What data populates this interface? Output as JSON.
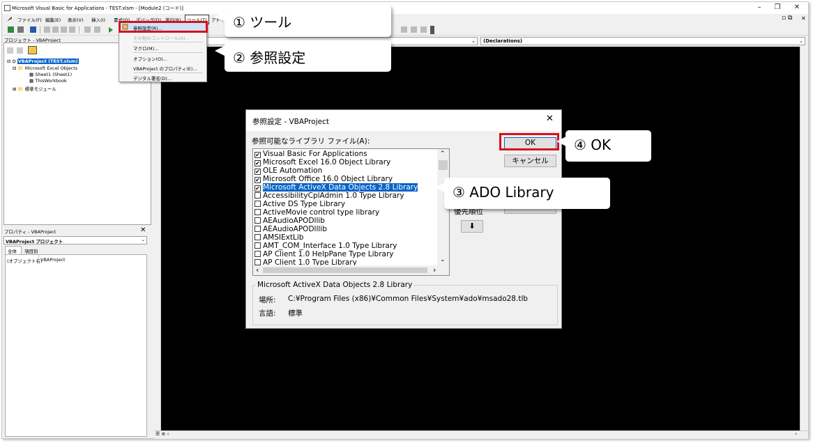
{
  "window": {
    "title": "Microsoft Visual Basic for Applications - TEST.xlsm - [Module2 (コード)]",
    "minimize": "–",
    "maximize": "❐",
    "close": "✕",
    "child_restore": "▫ ⧉",
    "child_close": "✕"
  },
  "menubar": [
    "ファイル(F)",
    "編集(E)",
    "表示(V)",
    "挿入(I)",
    "書式(O)",
    "デバッグ(D)",
    "実行(R)",
    "ツール(T)",
    "アドイン"
  ],
  "project_pane": {
    "header": "プロジェクト - VBAProject",
    "tree": [
      {
        "label": "VBAProject (TEST.xlsm)",
        "selected": true
      },
      {
        "label": "Microsoft Excel Objects"
      },
      {
        "label": "Sheet1 (Sheet1)"
      },
      {
        "label": "ThisWorkbook"
      },
      {
        "label": "標準モジュール"
      }
    ]
  },
  "properties_pane": {
    "header": "プロパティ - VBAProject",
    "close": "✕",
    "combo": "VBAProject プロジェクト",
    "tabs": [
      "全体",
      "項目別"
    ],
    "row_name": "(オブジェクト名)",
    "row_value": "VBAProject"
  },
  "code_window": {
    "object_combo": "",
    "procedure_combo": "(Declarations)"
  },
  "tools_menu": {
    "items": [
      "参照設定(R)...",
      "その他のコントロール(A)...",
      "マクロ(M)...",
      "オプション(O)...",
      "VBAProject のプロパティ(E)...",
      "デジタル署名(D)..."
    ]
  },
  "dialog": {
    "title": "参照設定 - VBAProject",
    "close": "✕",
    "list_label": "参照可能なライブラリ ファイル(A):",
    "libraries": [
      {
        "name": "Visual Basic For Applications",
        "checked": true
      },
      {
        "name": "Microsoft Excel 16.0 Object Library",
        "checked": true
      },
      {
        "name": "OLE Automation",
        "checked": true
      },
      {
        "name": "Microsoft Office 16.0 Object Library",
        "checked": true
      },
      {
        "name": "Microsoft ActiveX Data Objects 2.8 Library",
        "checked": true,
        "selected": true
      },
      {
        "name": "AccessibilityCplAdmin 1.0 Type Library",
        "checked": false
      },
      {
        "name": "Active DS Type Library",
        "checked": false
      },
      {
        "name": "ActiveMovie control type library",
        "checked": false
      },
      {
        "name": "AEAudioAPODllib",
        "checked": false
      },
      {
        "name": "AEAudioAPODlllib",
        "checked": false
      },
      {
        "name": "AMSIExtLib",
        "checked": false
      },
      {
        "name": "AMT_COM_Interface 1.0 Type Library",
        "checked": false
      },
      {
        "name": "AP Client 1.0 HelpPane Type Library",
        "checked": false
      },
      {
        "name": "AP Client 1.0 Type Library",
        "checked": false
      }
    ],
    "ok": "OK",
    "cancel": "キャンセル",
    "priority_label": "優先順位",
    "down_arrow": "⬇",
    "info_group": "Microsoft ActiveX Data Objects 2.8 Library",
    "location_label": "場所:",
    "location_value": "C:¥Program Files (x86)¥Common Files¥System¥ado¥msado28.tlb",
    "language_label": "言語:",
    "language_value": "標準"
  },
  "callouts": {
    "tools": "① ツール",
    "references": "② 参照設定",
    "ado": "③ ADO Library",
    "ok": "④ OK"
  },
  "colors": {
    "highlight_red": "#d8101a",
    "selection_blue": "#0a64c8",
    "code_background": "#000000"
  }
}
